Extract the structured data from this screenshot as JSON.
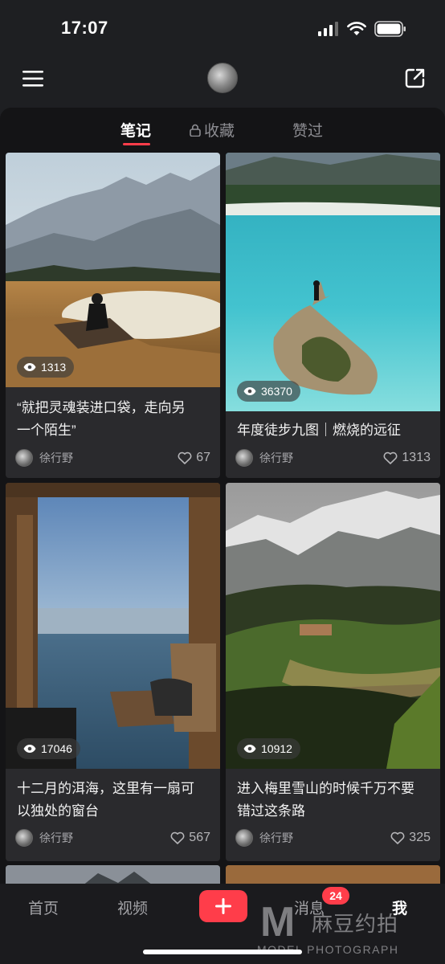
{
  "status_bar": {
    "time": "17:07"
  },
  "tabs": [
    {
      "label": "笔记",
      "active": true
    },
    {
      "label": "收藏",
      "locked": true
    },
    {
      "label": "赞过"
    }
  ],
  "cards": [
    {
      "views": "1313",
      "title_line1": "“就把灵魂装进口袋，走向另",
      "title_line2": "一个陌生”",
      "author": "徐行野",
      "likes": "67"
    },
    {
      "views": "36370",
      "title_line1": "年度徒步九图｜燃烧的远征",
      "title_line2": "",
      "author": "徐行野",
      "likes": "1313"
    },
    {
      "views": "17046",
      "title_line1": "十二月的洱海，这里有一扇可",
      "title_line2": "以独处的窗台",
      "author": "徐行野",
      "likes": "567"
    },
    {
      "views": "10912",
      "title_line1": "进入梅里雪山的时候千万不要",
      "title_line2": "错过这条路",
      "author": "徐行野",
      "likes": "325"
    }
  ],
  "bottom_nav": {
    "home": "首页",
    "video": "视频",
    "messages": "消息",
    "messages_badge": "24",
    "me": "我"
  },
  "watermark": {
    "letter": "M",
    "cn": "麻豆约拍",
    "en": "MODEL PHOTOGRAPH"
  },
  "colors": {
    "accent": "#ff3d4a",
    "background": "#141416",
    "card": "#2a2a2d"
  }
}
